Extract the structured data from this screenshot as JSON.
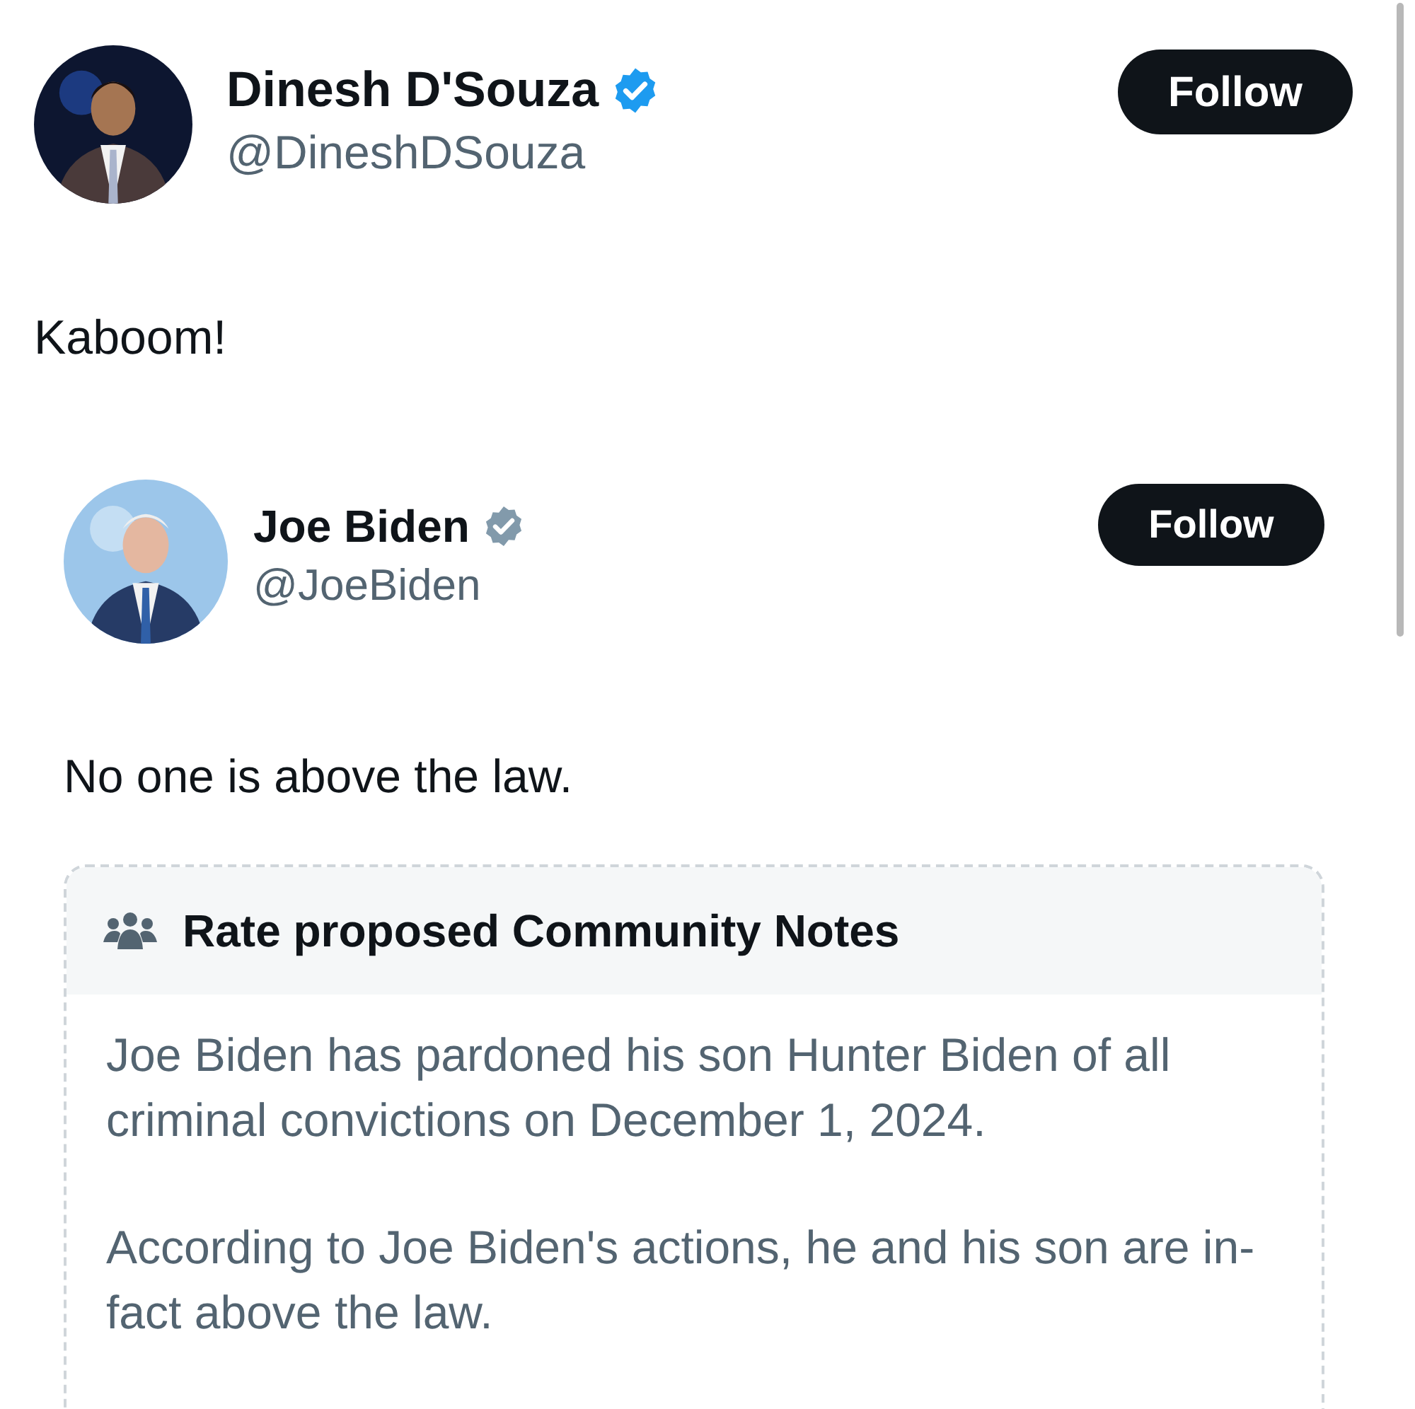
{
  "post": {
    "author": {
      "name": "Dinesh D'Souza",
      "handle": "@DineshDSouza",
      "badge": {
        "color": "#1d9bf0"
      },
      "follow": "Follow"
    },
    "text": "Kaboom!",
    "quoted": {
      "author": {
        "name": "Joe Biden",
        "handle": "@JoeBiden",
        "badge": {
          "color": "#829aab"
        },
        "follow": "Follow"
      },
      "text": "No one is above the law.",
      "community_notes": {
        "title": "Rate proposed Community Notes",
        "paragraphs": [
          "Joe Biden has pardoned his son Hunter Biden of all criminal convictions on December 1, 2024.",
          "According to Joe Biden's actions, he and his son are in-fact above the law."
        ]
      }
    }
  }
}
